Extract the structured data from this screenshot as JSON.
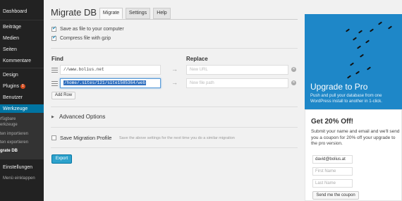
{
  "sidebar": {
    "items": [
      {
        "label": "Dashboard"
      },
      {
        "label": "Beiträge"
      },
      {
        "label": "Medien"
      },
      {
        "label": "Seiten"
      },
      {
        "label": "Kommentare"
      },
      {
        "label": "Design"
      },
      {
        "label": "Plugins",
        "badge": "1"
      },
      {
        "label": "Benutzer"
      },
      {
        "label": "Werkzeuge"
      },
      {
        "label": "Einstellungen"
      },
      {
        "label": "Menü einklappen"
      }
    ],
    "subitems": [
      {
        "label": "rfügbare"
      },
      {
        "label": "erkzeuge"
      },
      {
        "label": "ten importieren"
      },
      {
        "label": "ten exportieren"
      },
      {
        "label": "grate DB"
      }
    ]
  },
  "page": {
    "title": "Migrate DB",
    "tabs": [
      {
        "label": "Migrate"
      },
      {
        "label": "Settings"
      },
      {
        "label": "Help"
      }
    ]
  },
  "options": {
    "save_file": "Save as file to your computer",
    "compress": "Compress file with gzip"
  },
  "find_replace": {
    "find_heading": "Find",
    "replace_heading": "Replace",
    "rows": [
      {
        "find": "//www.bolius.net",
        "replace_placeholder": "New URL"
      },
      {
        "find": "/home/.sites/121/site1585364/web",
        "replace_placeholder": "New file path"
      }
    ],
    "add_row": "Add Row"
  },
  "advanced": {
    "label": "Advanced Options"
  },
  "save_profile": {
    "label": "Save Migration Profile",
    "hint": "Save the above settings for the next time you do a similar migration"
  },
  "export_button": "Export",
  "promo": {
    "title": "Upgrade to Pro",
    "text": "Push and pull your database from one WordPress install to another in 1-click."
  },
  "coupon": {
    "title": "Get 20% Off!",
    "text": "Submit your name and email and we'll send you a coupon for 20% off your upgrade to the pro version.",
    "email_value": "david@bolius.at",
    "first_name_placeholder": "First Name",
    "last_name_placeholder": "Last Name",
    "button": "Send me the coupon"
  },
  "colors": {
    "sidebar_bg": "#222222",
    "active_menu": "#0074a2",
    "accent": "#2ea2cc",
    "promo_bg": "#1e87c8"
  }
}
